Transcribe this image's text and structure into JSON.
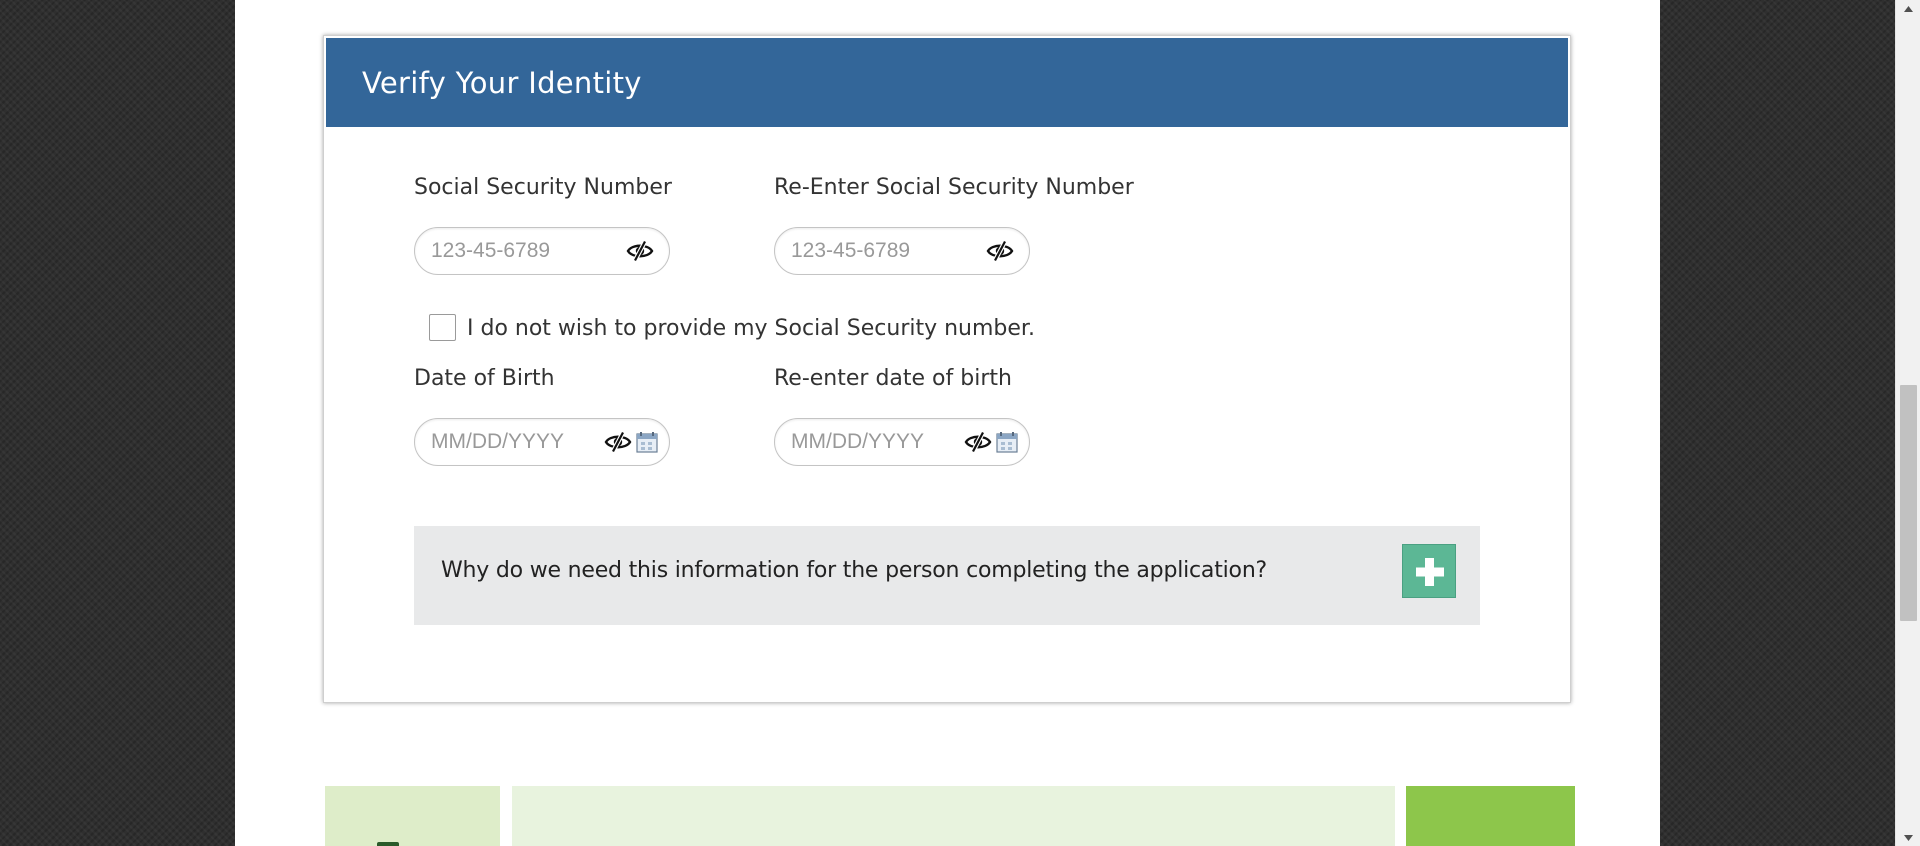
{
  "card": {
    "title": "Verify Your Identity"
  },
  "ssn": {
    "label": "Social Security Number",
    "placeholder": "123-45-6789"
  },
  "ssn_confirm": {
    "label": "Re-Enter Social Security Number",
    "placeholder": "123-45-6789"
  },
  "no_ssn": {
    "label": "I do not wish to provide my Social Security number.",
    "checked": false
  },
  "dob": {
    "label": "Date of Birth",
    "placeholder": "MM/DD/YYYY"
  },
  "dob_confirm": {
    "label": "Re-enter date of birth",
    "placeholder": "MM/DD/YYYY"
  },
  "info_accordion": {
    "question": "Why do we need this information for the person completing the application?",
    "expand_icon": "plus-icon"
  },
  "icons": {
    "visibility_toggle": "eye-slash-icon",
    "date_picker": "calendar-icon"
  },
  "colors": {
    "header": "#336699",
    "accordion_button": "#5cb795",
    "accordion_bg": "#e8e9ea",
    "tile_light": "#deedc9",
    "tile_lighter": "#e8f3de",
    "tile_accent": "#8dc64b"
  }
}
